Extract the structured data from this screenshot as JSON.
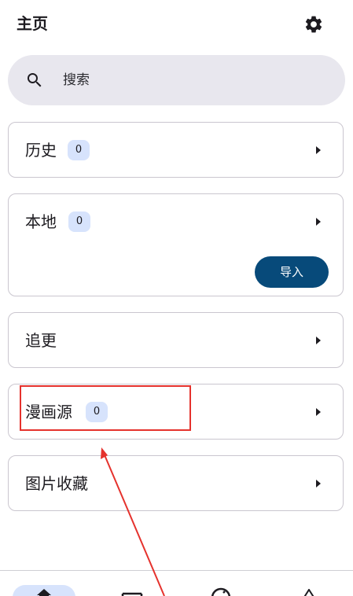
{
  "appbar": {
    "title": "主页",
    "settings_icon": "gear-icon"
  },
  "search": {
    "icon": "search-icon",
    "placeholder": "搜索"
  },
  "cards": {
    "history": {
      "label": "历史",
      "count": "0"
    },
    "local": {
      "label": "本地",
      "count": "0",
      "import_label": "导入"
    },
    "subscribe": {
      "label": "追更"
    },
    "sources": {
      "label": "漫画源",
      "count": "0"
    },
    "favorites": {
      "label": "图片收藏"
    }
  },
  "bottom_nav": {
    "items": [
      "home-icon",
      "image-icon",
      "explore-icon",
      "navigation-icon"
    ],
    "active": "home-icon"
  },
  "colors": {
    "accent": "#074a7a",
    "badge_bg": "#d7e3fc",
    "search_bg": "#e8e7ee",
    "annotation": "#e5322d"
  }
}
